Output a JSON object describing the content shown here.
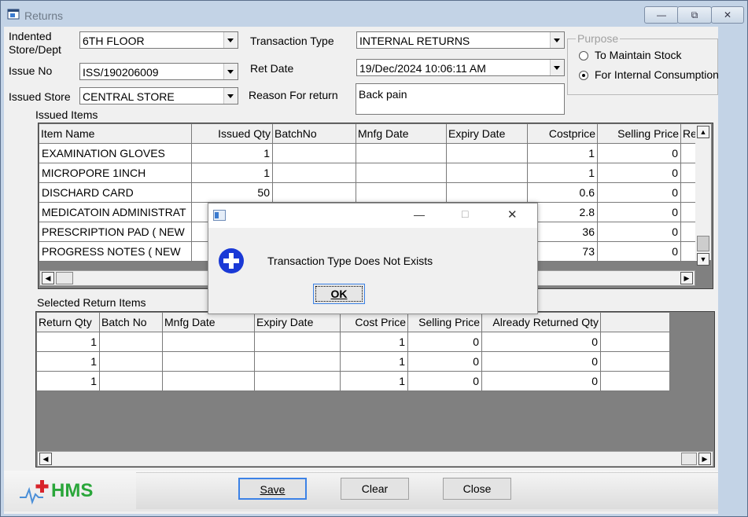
{
  "window": {
    "title": "Returns",
    "minimize": "—",
    "restore": "⧉",
    "close": "✕"
  },
  "form": {
    "indented_label": "Indented Store/Dept",
    "indented_value": "6TH FLOOR",
    "issue_no_label": "Issue No",
    "issue_no_value": "ISS/190206009",
    "issued_store_label": "Issued Store",
    "issued_store_value": "CENTRAL STORE",
    "transaction_type_label": "Transaction Type",
    "transaction_type_value": "INTERNAL RETURNS",
    "ret_date_label": "Ret Date",
    "ret_date_value": "19/Dec/2024 10:06:11 AM",
    "reason_label": "Reason For return",
    "reason_value": "Back pain"
  },
  "purpose": {
    "title": "Purpose",
    "options": [
      "To Maintain Stock",
      "For Internal Consumption"
    ],
    "selected": "For Internal Consumption"
  },
  "issued_items": {
    "title": "Issued Items",
    "columns": [
      "Item Name",
      "Issued Qty",
      "BatchNo",
      "Mnfg Date",
      "Expiry Date",
      "Costprice",
      "Selling Price",
      "Re"
    ],
    "rows": [
      [
        "EXAMINATION GLOVES",
        "1",
        "",
        "",
        "",
        "1",
        "0",
        ""
      ],
      [
        "MICROPORE 1INCH",
        "1",
        "",
        "",
        "",
        "1",
        "0",
        ""
      ],
      [
        "DISCHARD CARD",
        "50",
        "",
        "",
        "",
        "0.6",
        "0",
        ""
      ],
      [
        "MEDICATOIN ADMINISTRAT",
        "",
        "",
        "",
        "",
        "2.8",
        "0",
        ""
      ],
      [
        "PRESCRIPTION PAD ( NEW",
        "",
        "",
        "",
        "",
        "36",
        "0",
        ""
      ],
      [
        "PROGRESS NOTES ( NEW",
        "",
        "",
        "",
        "",
        "73",
        "0",
        ""
      ]
    ]
  },
  "return_items": {
    "title": "Selected Return Items",
    "columns": [
      "Return Qty",
      "Batch No",
      "Mnfg Date",
      "Expiry Date",
      "Cost Price",
      "Selling Price",
      "Already Returned Qty"
    ],
    "rows": [
      [
        "1",
        "",
        "",
        "",
        "1",
        "0",
        "0"
      ],
      [
        "1",
        "",
        "",
        "",
        "1",
        "0",
        "0"
      ],
      [
        "1",
        "",
        "",
        "",
        "1",
        "0",
        "0"
      ]
    ]
  },
  "footer": {
    "logo_text": "HMS",
    "save": "Save",
    "clear": "Clear",
    "close": "Close"
  },
  "dialog": {
    "message": "Transaction Type Does Not Exists",
    "ok": "OK",
    "min": "—",
    "max": "□",
    "close": "✕"
  },
  "colors": {
    "accent": "#3c82e6",
    "info_icon": "#1a39d6",
    "logo_green": "#2aa63a"
  }
}
